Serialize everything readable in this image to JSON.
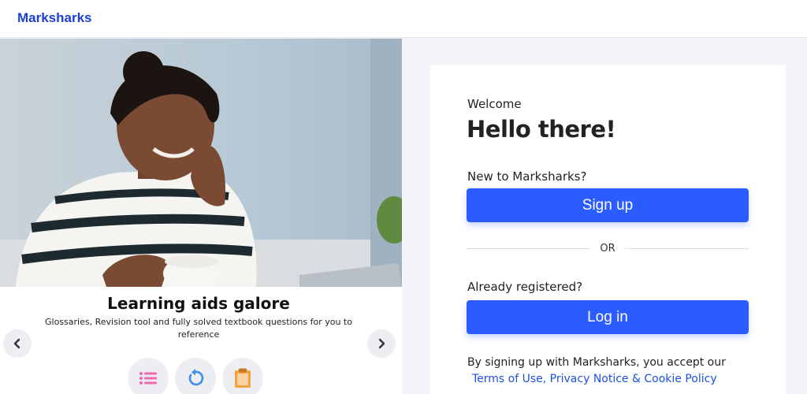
{
  "app": {
    "brand": "Marksharks"
  },
  "carousel": {
    "title": "Learning aids galore",
    "description": "Glossaries, Revision tool and fully solved textbook questions for you to reference",
    "prev_icon": "chevron-left-icon",
    "next_icon": "chevron-right-icon",
    "features": [
      {
        "icon": "list-icon",
        "color": "#f06ab0"
      },
      {
        "icon": "revision-icon",
        "color": "#3f8de8"
      },
      {
        "icon": "clipboard-icon",
        "color": "#f4a142"
      }
    ]
  },
  "auth": {
    "welcome": "Welcome",
    "heading": "Hello there!",
    "new_user_prompt": "New to Marksharks?",
    "signup_label": "Sign up",
    "or_label": "OR",
    "registered_prompt": "Already registered?",
    "login_label": "Log in",
    "terms_text": "By signing up with Marksharks, you accept our",
    "terms_link": "Terms of Use, Privacy Notice & Cookie Policy"
  },
  "colors": {
    "brand": "#1d3fd6",
    "button": "#2b5cff",
    "link": "#1d50e0"
  }
}
